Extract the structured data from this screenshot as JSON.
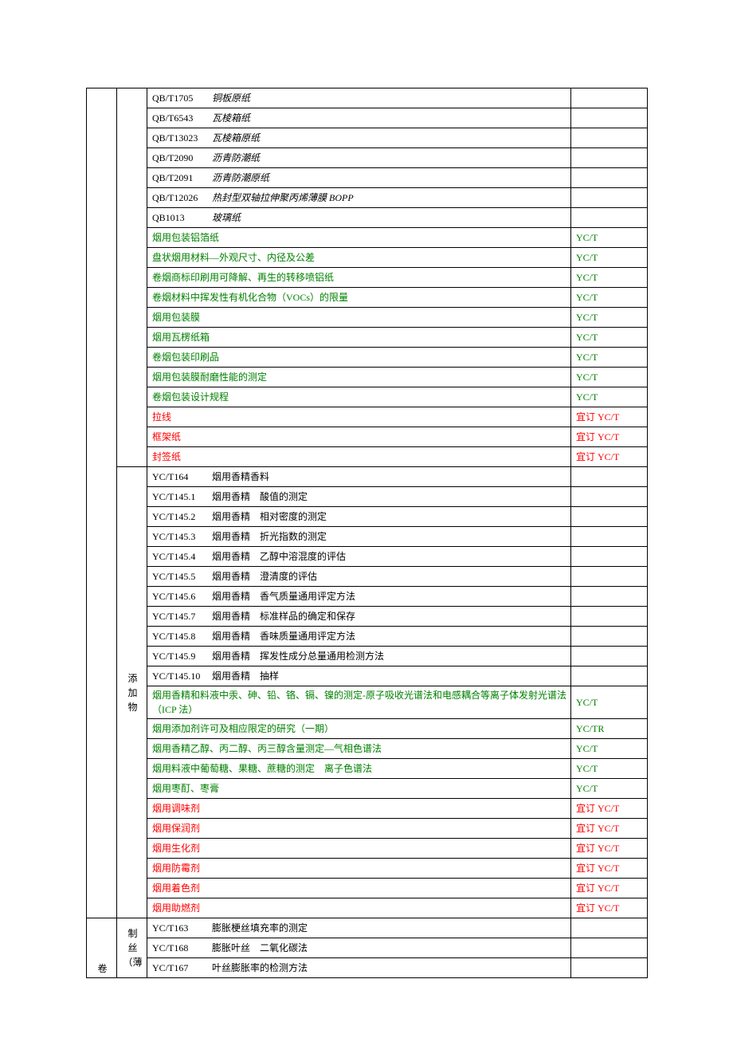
{
  "cols": {
    "c1_label": "卷",
    "c2a_label": "添\n加\n物",
    "c2b_label": "制\n丝\n（薄"
  },
  "rows_top": [
    {
      "style": "italic",
      "code": "QB/T1705",
      "name": "铜板原纸",
      "note": ""
    },
    {
      "style": "italic",
      "code": "QB/T6543",
      "name": "瓦棱箱纸",
      "note": ""
    },
    {
      "style": "italic",
      "code": "QB/T13023",
      "name": "瓦棱箱原纸",
      "note": ""
    },
    {
      "style": "italic",
      "code": "QB/T2090",
      "name": "沥青防潮纸",
      "note": ""
    },
    {
      "style": "italic",
      "code": "QB/T2091",
      "name": "沥青防潮原纸",
      "note": ""
    },
    {
      "style": "italic",
      "code": "QB/T12026",
      "name": "热封型双轴拉伸聚丙烯薄膜 BOPP",
      "note": ""
    },
    {
      "style": "italic",
      "code": "QB1013",
      "name": "玻璃纸",
      "note": ""
    },
    {
      "style": "green",
      "code": "",
      "name": "烟用包装铝箔纸",
      "note": "YC/T"
    },
    {
      "style": "green",
      "code": "",
      "name": "盘状烟用材料—外观尺寸、内径及公差",
      "note": "YC/T"
    },
    {
      "style": "green",
      "code": "",
      "name": "卷烟商标印刷用可降解、再生的转移喷铝纸",
      "note": "YC/T"
    },
    {
      "style": "green",
      "code": "",
      "name": "卷烟材料中挥发性有机化合物（VOCs）的限量",
      "note": "YC/T"
    },
    {
      "style": "green",
      "code": "",
      "name": "烟用包装膜",
      "note": "YC/T"
    },
    {
      "style": "green",
      "code": "",
      "name": "烟用瓦楞纸箱",
      "note": "YC/T"
    },
    {
      "style": "green",
      "code": "",
      "name": "卷烟包装印刷品",
      "note": "YC/T"
    },
    {
      "style": "green",
      "code": "",
      "name": "烟用包装膜耐磨性能的测定",
      "note": "YC/T"
    },
    {
      "style": "green",
      "code": "",
      "name": "卷烟包装设计规程",
      "note": "YC/T"
    },
    {
      "style": "red",
      "code": "",
      "name": "拉线",
      "note": "宜订 YC/T"
    },
    {
      "style": "red",
      "code": "",
      "name": "框架纸",
      "note": "宜订 YC/T"
    },
    {
      "style": "red",
      "code": "",
      "name": "封签纸",
      "note": "宜订 YC/T"
    }
  ],
  "rows_add": [
    {
      "style": "",
      "code": "YC/T164",
      "name": "烟用香精香料",
      "note": ""
    },
    {
      "style": "",
      "code": "YC/T145.1",
      "name": "烟用香精　酸值的测定",
      "note": ""
    },
    {
      "style": "",
      "code": "YC/T145.2",
      "name": "烟用香精　相对密度的测定",
      "note": ""
    },
    {
      "style": "",
      "code": "YC/T145.3",
      "name": "烟用香精　折光指数的测定",
      "note": ""
    },
    {
      "style": "",
      "code": "YC/T145.4",
      "name": "烟用香精　乙醇中溶混度的评估",
      "note": ""
    },
    {
      "style": "",
      "code": "YC/T145.5",
      "name": "烟用香精　澄清度的评估",
      "note": ""
    },
    {
      "style": "",
      "code": "YC/T145.6",
      "name": "烟用香精　香气质量通用评定方法",
      "note": ""
    },
    {
      "style": "",
      "code": "YC/T145.7",
      "name": "烟用香精　标准样品的确定和保存",
      "note": ""
    },
    {
      "style": "",
      "code": "YC/T145.8",
      "name": "烟用香精　香味质量通用评定方法",
      "note": ""
    },
    {
      "style": "",
      "code": "YC/T145.9",
      "name": "烟用香精　挥发性成分总量通用检测方法",
      "note": ""
    },
    {
      "style": "",
      "code": "YC/T145.10",
      "name": "烟用香精　抽样",
      "note": ""
    },
    {
      "style": "green",
      "code": "",
      "name": "烟用香精和料液中汞、砷、铅、铬、镉、镍的测定-原子吸收光谱法和电感耦合等离子体发射光谱法（ICP 法）",
      "note": "YC/T"
    },
    {
      "style": "green",
      "code": "",
      "name": "烟用添加剂许可及相应限定的研究（一期）",
      "note": "YC/TR"
    },
    {
      "style": "green",
      "code": "",
      "name": "烟用香精乙醇、丙二醇、丙三醇含量测定—气相色谱法",
      "note": "YC/T"
    },
    {
      "style": "green",
      "code": "",
      "name": "烟用料液中葡萄糖、果糖、蔗糖的测定　离子色谱法",
      "note": "YC/T"
    },
    {
      "style": "green",
      "code": "",
      "name": "烟用枣酊、枣膏",
      "note": "YC/T"
    },
    {
      "style": "red",
      "code": "",
      "name": "烟用调味剂",
      "note": "宜订 YC/T"
    },
    {
      "style": "red",
      "code": "",
      "name": "烟用保润剂",
      "note": "宜订 YC/T"
    },
    {
      "style": "red",
      "code": "",
      "name": "烟用生化剂",
      "note": "宜订 YC/T"
    },
    {
      "style": "red",
      "code": "",
      "name": "烟用防霉剂",
      "note": "宜订 YC/T"
    },
    {
      "style": "red",
      "code": "",
      "name": "烟用着色剂",
      "note": "宜订 YC/T"
    },
    {
      "style": "red",
      "code": "",
      "name": "烟用助燃剂",
      "note": "宜订 YC/T"
    }
  ],
  "rows_zs": [
    {
      "style": "",
      "code": "YC/T163",
      "name": "膨胀梗丝填充率的测定",
      "note": ""
    },
    {
      "style": "",
      "code": "YC/T168",
      "name": "膨胀叶丝　二氧化碳法",
      "note": ""
    },
    {
      "style": "",
      "code": "YC/T167",
      "name": "叶丝膨胀率的检测方法",
      "note": ""
    }
  ]
}
